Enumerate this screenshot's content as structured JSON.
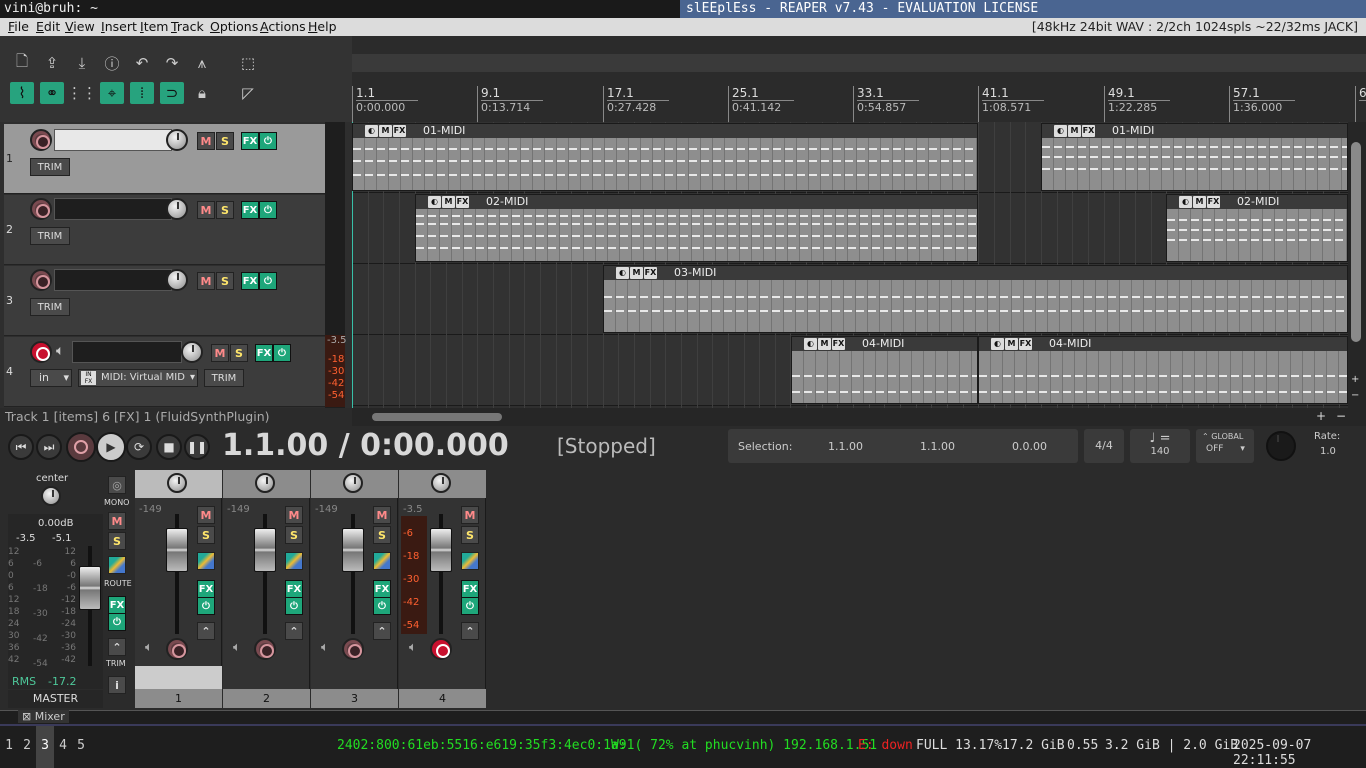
{
  "wm": {
    "left_title": "vini@bruh: ~",
    "window_title": "slEEplEss - REAPER v7.43 - EVALUATION LICENSE"
  },
  "menu": {
    "items": [
      "File",
      "Edit",
      "View",
      "Insert",
      "Item",
      "Track",
      "Options",
      "Actions",
      "Help"
    ],
    "audio_status": "[48kHz 24bit WAV : 2/2ch 1024spls ~22/32ms JACK]"
  },
  "ruler": [
    {
      "bar": "1.1",
      "time": "0:00.000"
    },
    {
      "bar": "9.1",
      "time": "0:13.714"
    },
    {
      "bar": "17.1",
      "time": "0:27.428"
    },
    {
      "bar": "25.1",
      "time": "0:41.142"
    },
    {
      "bar": "33.1",
      "time": "0:54.857"
    },
    {
      "bar": "41.1",
      "time": "1:08.571"
    },
    {
      "bar": "49.1",
      "time": "1:22.285"
    },
    {
      "bar": "57.1",
      "time": "1:36.000"
    },
    {
      "bar": "6",
      "time": ""
    }
  ],
  "tracks": [
    {
      "num": "1",
      "trim": "TRIM",
      "mute": "M",
      "solo": "S",
      "fx": "FX"
    },
    {
      "num": "2",
      "trim": "TRIM",
      "mute": "M",
      "solo": "S",
      "fx": "FX"
    },
    {
      "num": "3",
      "trim": "TRIM",
      "mute": "M",
      "solo": "S",
      "fx": "FX"
    },
    {
      "num": "4",
      "trim": "TRIM",
      "mute": "M",
      "solo": "S",
      "fx": "FX",
      "input": "in",
      "midi_input": "MIDI: Virtual MID"
    }
  ],
  "tcp_meter": {
    "peak": "-3.5",
    "scale": [
      "-18",
      "-30",
      "-42",
      "-54"
    ]
  },
  "items": {
    "i1": "01-MIDI",
    "i2": "02-MIDI",
    "i3": "03-MIDI",
    "i4": "04-MIDI",
    "m": "M",
    "fx": "FX"
  },
  "track_info": "Track 1 [items] 6 [FX] 1 (FluidSynthPlugin)",
  "transport": {
    "time": "1.1.00 / 0:00.000",
    "state": "[Stopped]",
    "selection_label": "Selection:",
    "sel_start": "1.1.00",
    "sel_end": "1.1.00",
    "sel_len": "0.0.00",
    "timesig": "4/4",
    "bpm_symbol": "♩ =",
    "bpm": "140",
    "global_label": "GLOBAL",
    "global_state": "OFF",
    "rate_label": "Rate:",
    "rate": "1.0"
  },
  "master": {
    "pan": "center",
    "vol": "0.00dB",
    "peak_l": "-3.5",
    "peak_r": "-5.1",
    "scale_left": [
      "12",
      "6",
      "0",
      "6",
      "12",
      "18",
      "24",
      "30",
      "36",
      "42"
    ],
    "scale_mid": [
      "-6",
      "-18",
      "-30",
      "-42",
      "-54"
    ],
    "scale_right": [
      "12",
      "6",
      "-0",
      "-6",
      "-12",
      "-18",
      "-24",
      "-30",
      "-36",
      "-42"
    ],
    "mono": "MONO",
    "route": "ROUTE",
    "trim": "TRIM",
    "rms_label": "RMS",
    "rms": "-17.2",
    "name": "MASTER",
    "m": "M",
    "s": "S",
    "fx": "FX",
    "info": "i"
  },
  "strips": [
    {
      "num": "1",
      "level": "-149"
    },
    {
      "num": "2",
      "level": "-149"
    },
    {
      "num": "3",
      "level": "-149"
    },
    {
      "num": "4",
      "level": "-3.5",
      "scale": [
        "-6",
        "-18",
        "-30",
        "-42",
        "-54"
      ]
    }
  ],
  "mixer_tab": "Mixer",
  "taskbar": {
    "workspaces": [
      "1",
      "2",
      "3",
      "4",
      "5"
    ],
    "ipv6": "2402:800:61eb:5516:e619:35f3:4ec0:1a91",
    "wifi": "W: ( 72% at phucvinh) 192.168.1.51",
    "eth": "E: down",
    "disk": "FULL 13.17%",
    "disk_free": "17.2 GiB",
    "load": "0.55",
    "mem": "3.2 GiB | 2.0 GiB",
    "datetime": "2025-09-07 22:11:55"
  }
}
